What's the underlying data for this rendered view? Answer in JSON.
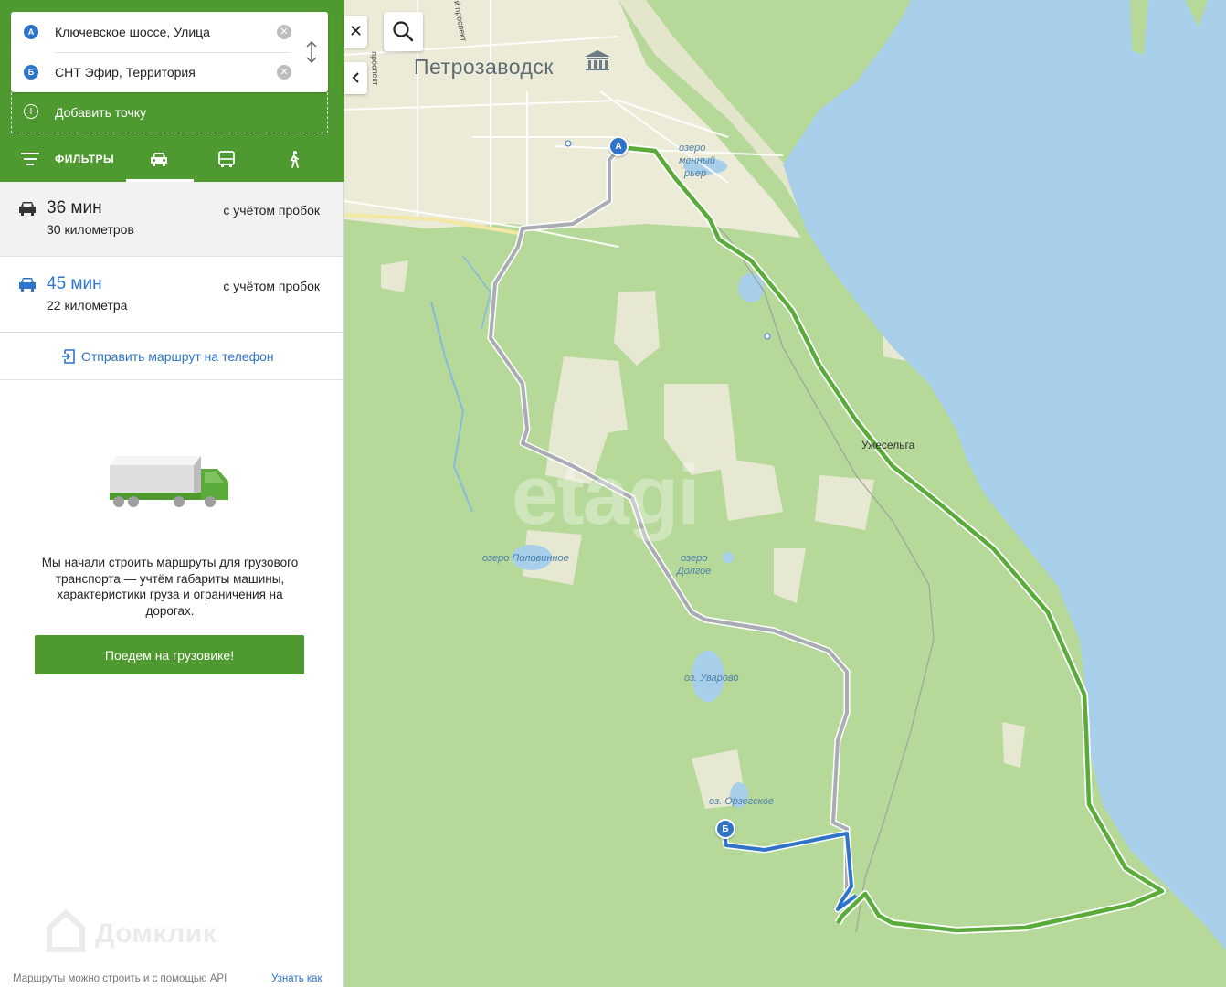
{
  "route_form": {
    "point_a": {
      "marker": "А",
      "value": "Ключевское шоссе, Улица"
    },
    "point_b": {
      "marker": "Б",
      "value": "СНТ Эфир, Территория"
    },
    "add_point_label": "Добавить точку"
  },
  "tabs": {
    "filters_label": "ФИЛЬТРЫ",
    "modes": [
      "car-icon",
      "bus-icon",
      "walk-icon"
    ],
    "active": "car"
  },
  "routes": [
    {
      "time": "36 мин",
      "distance": "30 километров",
      "traffic": "с учётом пробок",
      "selected": true
    },
    {
      "time": "45 мин",
      "distance": "22 километра",
      "traffic": "с учётом пробок",
      "selected": false
    }
  ],
  "send_to_phone_label": "Отправить маршрут на телефон",
  "truck_promo": {
    "text": "Мы начали строить маршруты для грузового транспорта — учтём габариты машины, характеристики груза и ограничения на дорогах.",
    "button_label": "Поедем на грузовике!"
  },
  "footer": {
    "watermark": "Домклик",
    "note": "Маршруты можно строить и с помощью API",
    "link": "Узнать как"
  },
  "map": {
    "city_label": "Петрозаводск",
    "place_labels": {
      "uzheselga": "Ужесельга",
      "lake_kamenny_1": "озеро",
      "lake_kamenny_2": "менный",
      "lake_kamenny_3": "рьер",
      "lake_polovinnoe": "озеро Половинное",
      "lake_dolgoe_1": "озеро",
      "lake_dolgoe_2": "Долгое",
      "lake_uvarovo": "оз. Уварово",
      "lake_orzegskoe": "оз. Орзегское"
    },
    "road_labels": {
      "prospekt_1": "й проспект",
      "prospekt_2": "проспект"
    },
    "watermark": "etagi",
    "marker_a": "А",
    "marker_b": "Б",
    "colors": {
      "forest": "#b6d99a",
      "water": "#a7cfea",
      "clearing": "#e6e8d2",
      "route_main": "#5aab3a",
      "route_alt": "#a9acb2",
      "route_local": "#2f74c9",
      "brand": "#4f9a30"
    }
  }
}
